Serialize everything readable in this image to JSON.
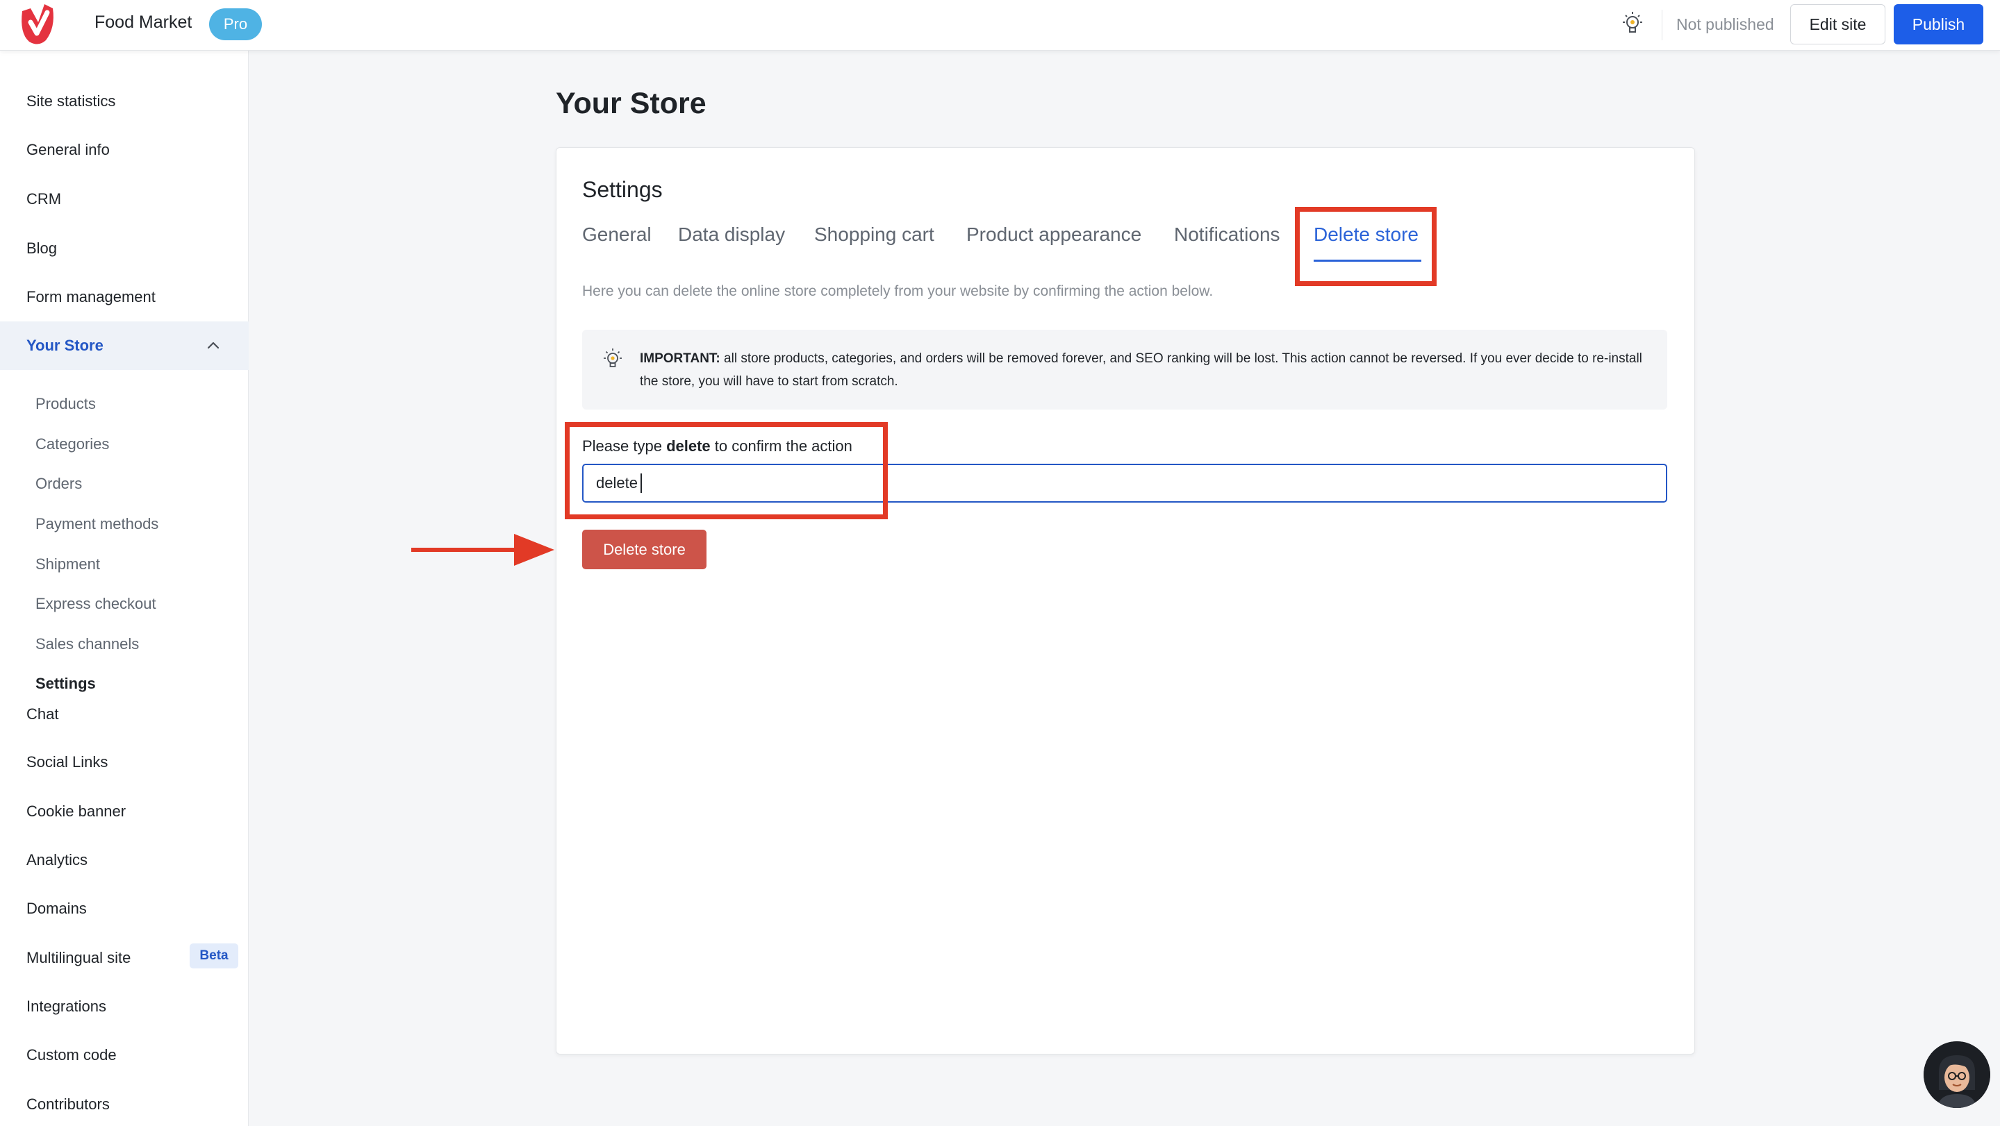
{
  "app": {
    "logo_icon": "food-market-logo-icon",
    "name": "Food Market",
    "plan_badge": "Pro",
    "brand_color": "#e4333f"
  },
  "topbar": {
    "tips_icon": "lightbulb-icon",
    "status": "Not published",
    "edit_label": "Edit site",
    "publish_label": "Publish",
    "accent": "#1d5ee8"
  },
  "sidebar": {
    "items": [
      {
        "label": "Site statistics"
      },
      {
        "label": "General info"
      },
      {
        "label": "CRM"
      },
      {
        "label": "Blog"
      },
      {
        "label": "Form management"
      },
      {
        "label": "Your Store",
        "expanded": true,
        "icon": "chevron-up-icon"
      },
      {
        "label": "Chat"
      },
      {
        "label": "Social Links"
      },
      {
        "label": "Cookie banner"
      },
      {
        "label": "Analytics"
      },
      {
        "label": "Domains"
      },
      {
        "label": "Multilingual site",
        "badge": "Beta"
      },
      {
        "label": "Integrations"
      },
      {
        "label": "Custom code"
      },
      {
        "label": "Contributors"
      }
    ],
    "store_subitems": [
      {
        "label": "Products"
      },
      {
        "label": "Categories"
      },
      {
        "label": "Orders"
      },
      {
        "label": "Payment methods"
      },
      {
        "label": "Shipment"
      },
      {
        "label": "Express checkout"
      },
      {
        "label": "Sales channels"
      },
      {
        "label": "Settings",
        "current": true
      }
    ]
  },
  "main": {
    "title": "Your Store",
    "settings_title": "Settings",
    "tabs": [
      {
        "label": "General"
      },
      {
        "label": "Data display"
      },
      {
        "label": "Shopping cart"
      },
      {
        "label": "Product appearance"
      },
      {
        "label": "Notifications"
      },
      {
        "label": "Delete store",
        "active": true
      }
    ],
    "description": "Here you can delete the online store completely from your website by confirming the action below.",
    "alert": {
      "icon": "lightbulb-icon",
      "strong": "IMPORTANT:",
      "text": " all store products, categories, and orders will be removed forever, and SEO ranking will be lost. This action cannot be reversed. If you ever decide to re-install the store, you will have to start from scratch."
    },
    "confirm": {
      "label_prefix": "Please type ",
      "label_keyword": "delete",
      "label_suffix": " to confirm the action",
      "value": "delete"
    },
    "delete_button": "Delete store",
    "danger_color": "#cd5449",
    "annotation_color": "#e23a26"
  },
  "chat": {
    "avatar_icon": "support-avatar-icon"
  }
}
